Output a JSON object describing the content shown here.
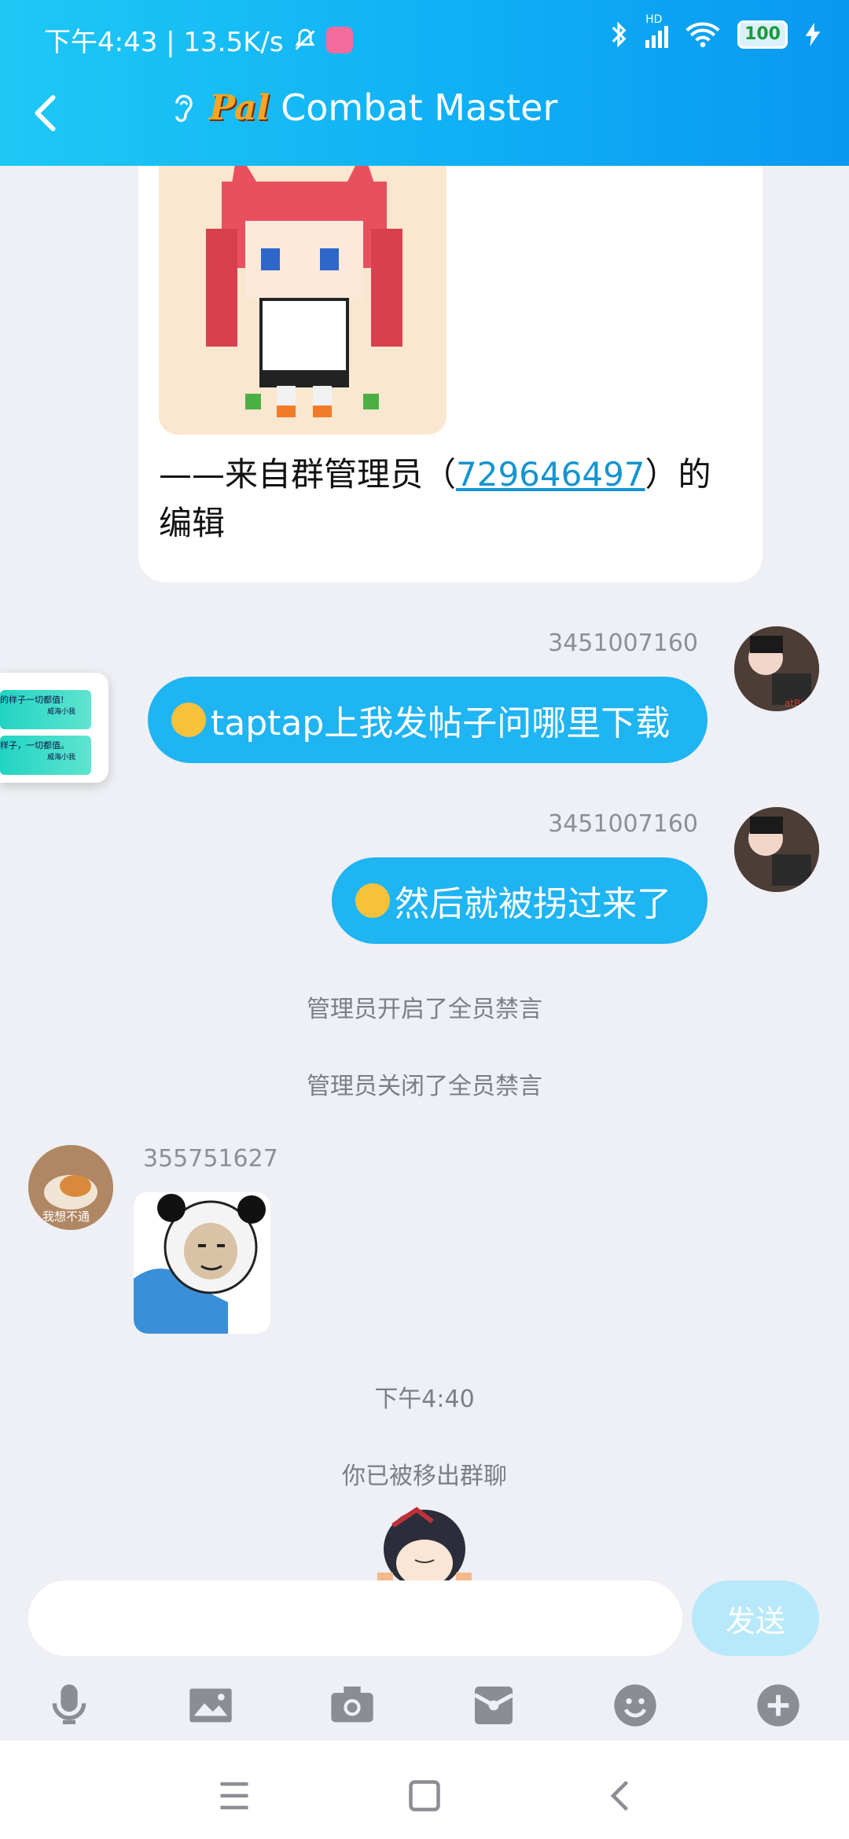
{
  "status_bar": {
    "time_speed": "下午4:43 | 13.5K/s",
    "hd": "HD",
    "battery": "100"
  },
  "header": {
    "logo_text": "Pal",
    "title": "Combat Master"
  },
  "announcement": {
    "prefix": "——来自群管理员（",
    "admin_id": "729646497",
    "suffix": "）的编辑"
  },
  "float_panel": {
    "item1": "的样子一切都值!",
    "item1_sub": "威海小我",
    "item2": "样子，一切都值。",
    "item2_sub": "威海小我"
  },
  "messages": [
    {
      "sender": "3451007160",
      "text": "taptap上我发帖子问哪里下载"
    },
    {
      "sender": "3451007160",
      "text": "然后就被拐过来了"
    }
  ],
  "system": {
    "mute_on": "管理员开启了全员禁言",
    "mute_off": "管理员关闭了全员禁言",
    "time": "下午4:40",
    "removed": "你已被移出群聊"
  },
  "other_message": {
    "sender": "355751627",
    "avatar_caption": "我想不通"
  },
  "avatar_tag": "atBird",
  "composer": {
    "placeholder": "",
    "send_label": "发送"
  },
  "colors": {
    "header": "#0fb0f5",
    "bubble": "#1fb4f2",
    "background": "#eef0f5"
  }
}
